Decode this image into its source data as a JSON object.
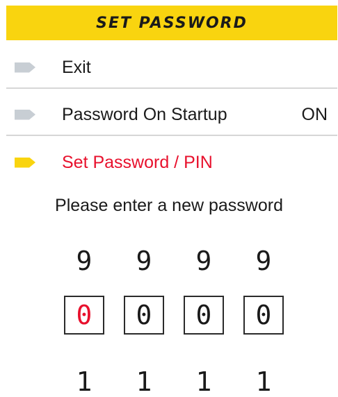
{
  "header": {
    "title": "SET PASSWORD"
  },
  "menu": {
    "items": [
      {
        "label": "Exit",
        "value": ""
      },
      {
        "label": "Password On Startup",
        "value": "ON"
      },
      {
        "label": "Set Password / PIN",
        "value": ""
      }
    ]
  },
  "pin_entry": {
    "prompt": "Please enter a new password",
    "above_digits": [
      "9",
      "9",
      "9",
      "9"
    ],
    "current_digits": [
      "0",
      "0",
      "0",
      "0"
    ],
    "below_digits": [
      "1",
      "1",
      "1",
      "1"
    ],
    "active_index": 0
  },
  "colors": {
    "accent_yellow": "#f9d40f",
    "active_red": "#e8112d",
    "bullet_grey": "#c8ced4"
  }
}
